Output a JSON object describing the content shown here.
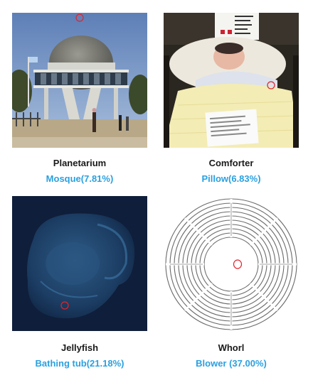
{
  "panels": [
    {
      "true_label": "Planetarium",
      "predicted_label": "Mosque(7.81%)"
    },
    {
      "true_label": "Comforter",
      "predicted_label": "Pillow(6.83%)"
    },
    {
      "true_label": "Jellyfish",
      "predicted_label": "Bathing tub(21.18%)"
    },
    {
      "true_label": "Whorl",
      "predicted_label": "Blower (37.00%)"
    }
  ],
  "colors": {
    "predicted_text": "#2aa0e0",
    "marker_circle": "#e0242c"
  }
}
